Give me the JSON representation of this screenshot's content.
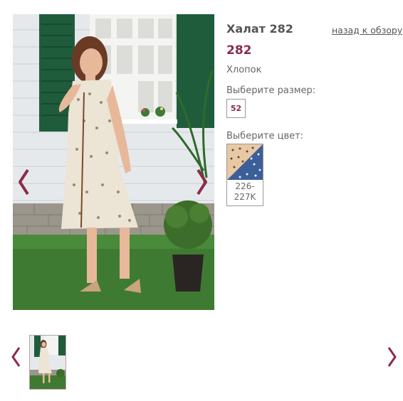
{
  "product": {
    "name": "Халат 282",
    "price": "282",
    "material": "Хлопок",
    "back_link": "назад к обзору"
  },
  "size": {
    "label": "Выберите размер:",
    "options": [
      "52"
    ]
  },
  "color": {
    "label": "Выберите цвет:",
    "options": [
      {
        "code": "226-227K",
        "swatch_colors": [
          "#e8c9a4",
          "#3d5f98"
        ]
      }
    ]
  },
  "gallery": {
    "thumbnail_count": 1,
    "selected_index": 0
  },
  "colors": {
    "accent": "#8c2b4a",
    "text": "#555555",
    "wall": "#e9ecef",
    "shutter": "#1f5c3c",
    "grass": "#3f7a33"
  }
}
